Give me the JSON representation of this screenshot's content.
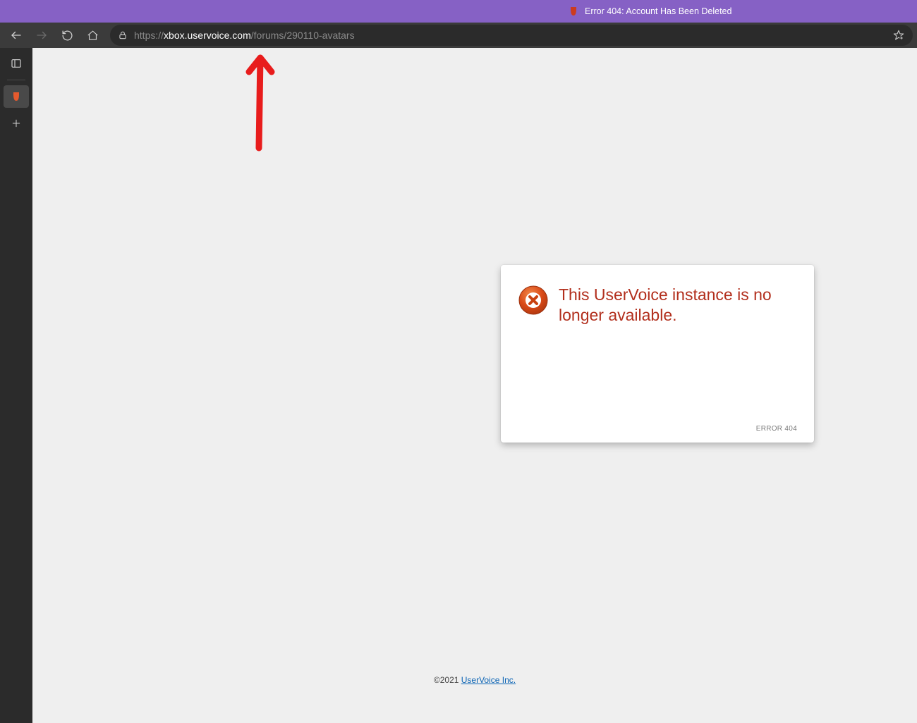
{
  "titlebar": {
    "title": "Error 404: Account Has Been Deleted"
  },
  "toolbar": {
    "url_scheme": "https",
    "url_sep": "://",
    "url_host": "xbox.uservoice.com",
    "url_path": "/forums/290110-avatars"
  },
  "card": {
    "message": "This UserVoice instance is no longer available.",
    "error_code": "ERROR 404"
  },
  "footer": {
    "copyright_prefix": "©2021 ",
    "link_text": "UserVoice Inc."
  }
}
